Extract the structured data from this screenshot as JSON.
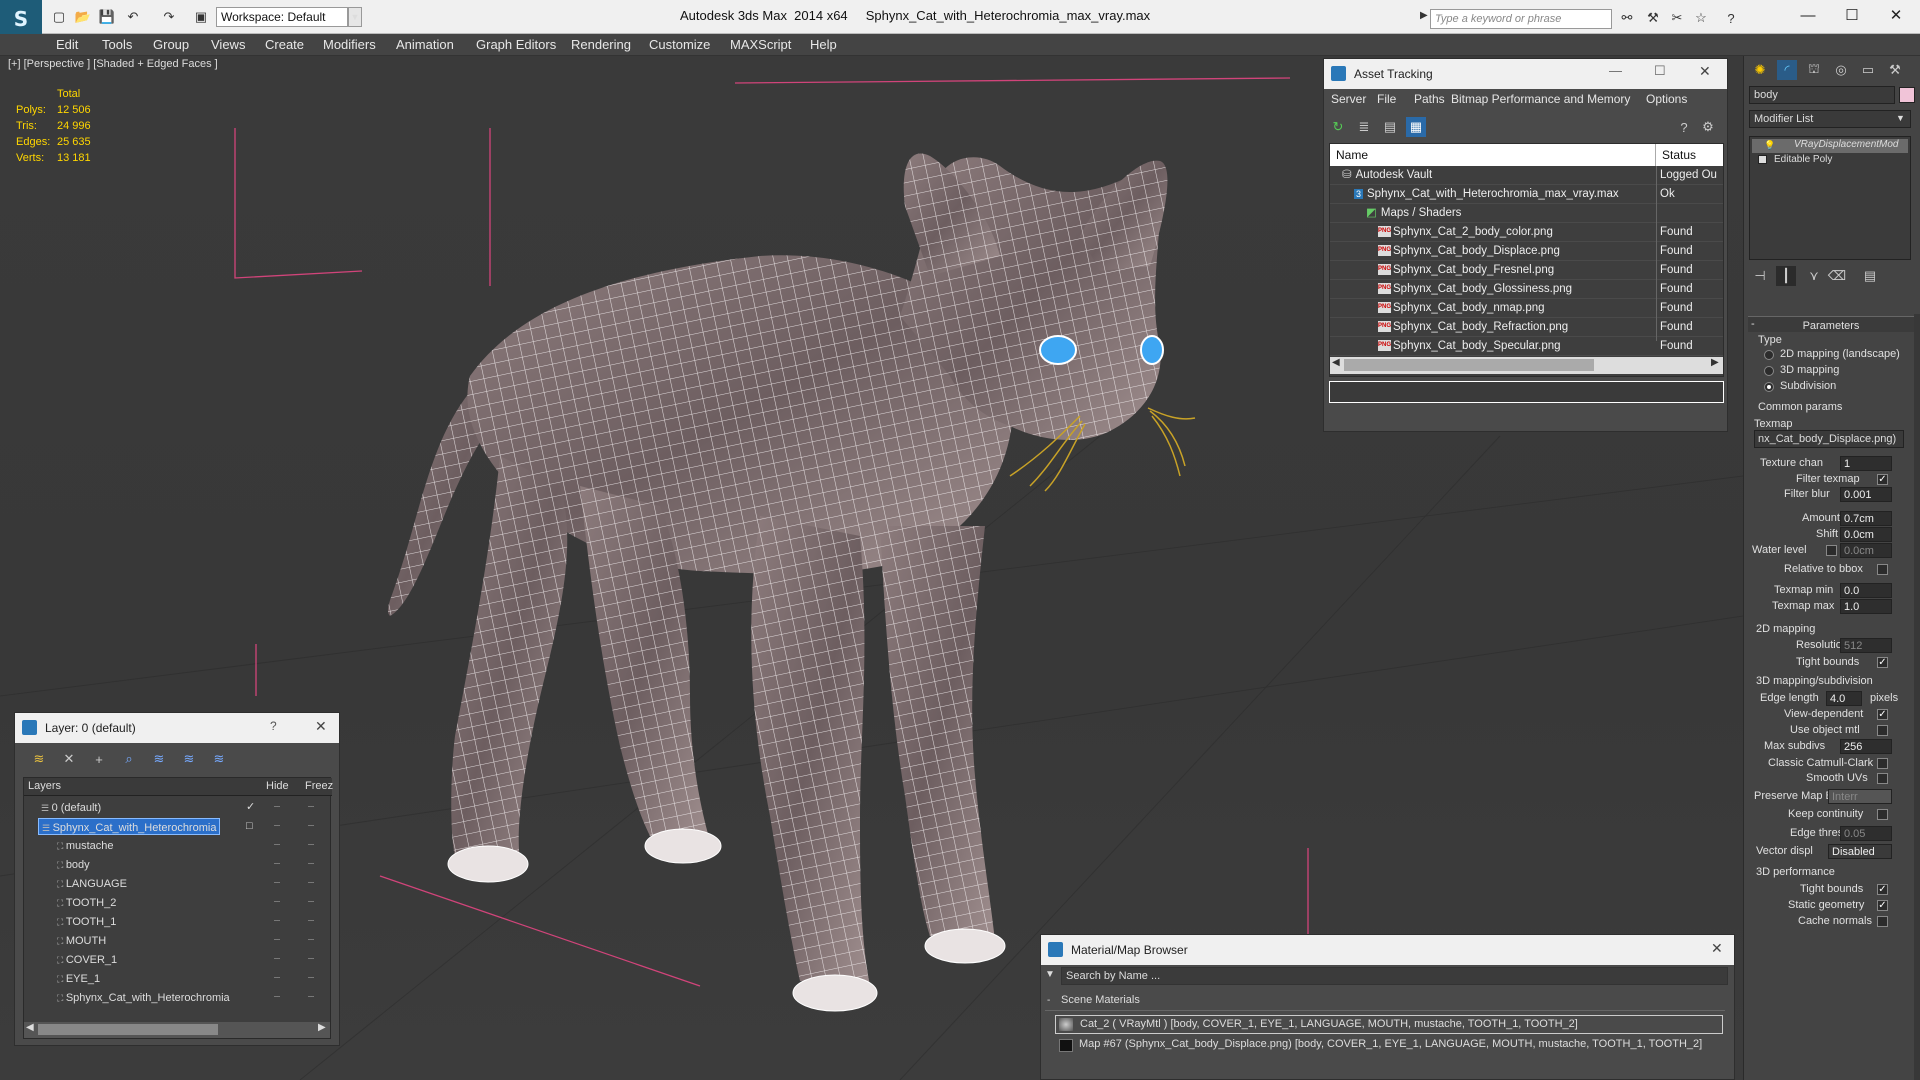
{
  "app": {
    "title": "Autodesk 3ds Max  2014 x64     Sphynx_Cat_with_Heterochromia_max_vray.max",
    "workspace_label": "Workspace: Default",
    "search_placeholder": "Type a keyword or phrase"
  },
  "menu": [
    "Edit",
    "Tools",
    "Group",
    "Views",
    "Create",
    "Modifiers",
    "Animation",
    "Graph Editors",
    "Rendering",
    "Customize",
    "MAXScript",
    "Help"
  ],
  "viewport": {
    "label": "[+] [Perspective ] [Shaded + Edged Faces ]",
    "stats_header": "Total",
    "stats": [
      {
        "label": "Polys:",
        "value": "12 506"
      },
      {
        "label": "Tris:",
        "value": "24 996"
      },
      {
        "label": "Edges:",
        "value": "25 635"
      },
      {
        "label": "Verts:",
        "value": "13 181"
      }
    ]
  },
  "asset_tracking": {
    "title": "Asset Tracking",
    "menu": [
      "Server",
      "File",
      "Paths",
      "Bitmap Performance and Memory",
      "Options"
    ],
    "columns": [
      "Name",
      "Status"
    ],
    "rows": [
      {
        "name": "Autodesk Vault",
        "status": "Logged Ou",
        "indent": 1,
        "icon": "vault"
      },
      {
        "name": "Sphynx_Cat_with_Heterochromia_max_vray.max",
        "status": "Ok",
        "indent": 2,
        "icon": "max"
      },
      {
        "name": "Maps / Shaders",
        "status": "",
        "indent": 3,
        "icon": "folder"
      },
      {
        "name": "Sphynx_Cat_2_body_color.png",
        "status": "Found",
        "indent": 4,
        "icon": "png"
      },
      {
        "name": "Sphynx_Cat_body_Displace.png",
        "status": "Found",
        "indent": 4,
        "icon": "png"
      },
      {
        "name": "Sphynx_Cat_body_Fresnel.png",
        "status": "Found",
        "indent": 4,
        "icon": "png"
      },
      {
        "name": "Sphynx_Cat_body_Glossiness.png",
        "status": "Found",
        "indent": 4,
        "icon": "png"
      },
      {
        "name": "Sphynx_Cat_body_nmap.png",
        "status": "Found",
        "indent": 4,
        "icon": "png"
      },
      {
        "name": "Sphynx_Cat_body_Refraction.png",
        "status": "Found",
        "indent": 4,
        "icon": "png"
      },
      {
        "name": "Sphynx_Cat_body_Specular.png",
        "status": "Found",
        "indent": 4,
        "icon": "png"
      }
    ]
  },
  "layer_window": {
    "title": "Layer: 0 (default)",
    "help": "?",
    "columns": [
      "Layers",
      "Hide",
      "Freez"
    ],
    "rows": [
      {
        "name": "0 (default)",
        "level": 0,
        "selected": false,
        "check": "✓"
      },
      {
        "name": "Sphynx_Cat_with_Heterochromia",
        "level": 0,
        "selected": true,
        "check": "□"
      },
      {
        "name": "mustache",
        "level": 1,
        "selected": false,
        "check": ""
      },
      {
        "name": "body",
        "level": 1,
        "selected": false,
        "check": ""
      },
      {
        "name": "LANGUAGE",
        "level": 1,
        "selected": false,
        "check": ""
      },
      {
        "name": "TOOTH_2",
        "level": 1,
        "selected": false,
        "check": ""
      },
      {
        "name": "TOOTH_1",
        "level": 1,
        "selected": false,
        "check": ""
      },
      {
        "name": "MOUTH",
        "level": 1,
        "selected": false,
        "check": ""
      },
      {
        "name": "COVER_1",
        "level": 1,
        "selected": false,
        "check": ""
      },
      {
        "name": "EYE_1",
        "level": 1,
        "selected": false,
        "check": ""
      },
      {
        "name": "Sphynx_Cat_with_Heterochromia",
        "level": 1,
        "selected": false,
        "check": ""
      }
    ]
  },
  "material_browser": {
    "title": "Material/Map Browser",
    "search_placeholder": "Search by Name ...",
    "section": "Scene Materials",
    "items": [
      "Cat_2  ( VRayMtl )  [body, COVER_1, EYE_1, LANGUAGE, MOUTH, mustache, TOOTH_1, TOOTH_2]",
      "Map #67 (Sphynx_Cat_body_Displace.png)  [body, COVER_1, EYE_1, LANGUAGE, MOUTH, mustache, TOOTH_1, TOOTH_2]"
    ]
  },
  "command_panel": {
    "object_name": "body",
    "modifier_list": "Modifier List",
    "stack": [
      "VRayDisplacementMod",
      "Editable Poly"
    ],
    "parameters_title": "Parameters",
    "type_label": "Type",
    "type_options": [
      {
        "label": "2D mapping (landscape)",
        "on": false
      },
      {
        "label": "3D mapping",
        "on": false
      },
      {
        "label": "Subdivision",
        "on": true
      }
    ],
    "common_params": "Common params",
    "texmap_label": "Texmap",
    "texmap_value": "nx_Cat_body_Displace.png)",
    "texture_chan": {
      "label": "Texture chan",
      "value": "1"
    },
    "filter_texmap": {
      "label": "Filter texmap",
      "checked": "✓"
    },
    "filter_blur": {
      "label": "Filter blur",
      "value": "0.001"
    },
    "amount": {
      "label": "Amount",
      "value": "0.7cm"
    },
    "shift": {
      "label": "Shift",
      "value": "0.0cm"
    },
    "water_level": {
      "label": "Water level",
      "value": "0.0cm"
    },
    "relative_bbox": "Relative to bbox",
    "texmap_min": {
      "label": "Texmap min",
      "value": "0.0"
    },
    "texmap_max": {
      "label": "Texmap max",
      "value": "1.0"
    },
    "mapping2d": "2D mapping",
    "resolution": {
      "label": "Resolution",
      "value": "512"
    },
    "tight_bounds_1": {
      "label": "Tight bounds",
      "checked": "✓"
    },
    "mapping3d": "3D mapping/subdivision",
    "edge_length": {
      "label": "Edge length",
      "value": "4.0",
      "unit": "pixels"
    },
    "view_dependent": {
      "label": "View-dependent",
      "checked": "✓"
    },
    "use_object_mtl": {
      "label": "Use object mtl",
      "checked": ""
    },
    "max_subdivs": {
      "label": "Max subdivs",
      "value": "256"
    },
    "classic_catmull": {
      "label": "Classic Catmull-Clark",
      "checked": ""
    },
    "smooth_uvs": {
      "label": "Smooth UVs",
      "checked": ""
    },
    "preserve_map": {
      "label": "Preserve Map Bnd",
      "value": "Interr"
    },
    "keep_continuity": {
      "label": "Keep continuity",
      "checked": ""
    },
    "edge_thresh": {
      "label": "Edge thresh",
      "value": "0.05"
    },
    "vector_displ": {
      "label": "Vector displ",
      "value": "Disabled"
    },
    "perf3d": "3D performance",
    "tight_bounds_2": {
      "label": "Tight bounds",
      "checked": "✓"
    },
    "static_geometry": {
      "label": "Static geometry",
      "checked": "✓"
    },
    "cache_normals": {
      "label": "Cache normals",
      "checked": ""
    }
  }
}
